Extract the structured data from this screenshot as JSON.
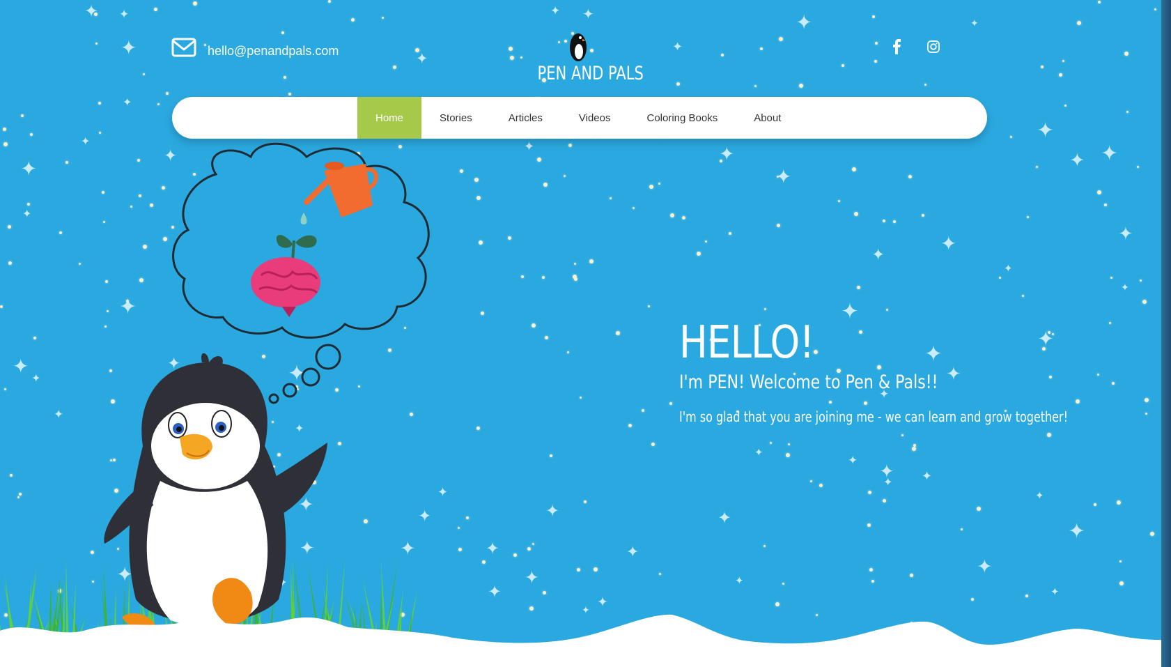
{
  "header": {
    "email": "hello@penandpals.com",
    "logo_text": "PEN AND PALS",
    "social_icons": [
      "facebook-icon",
      "instagram-icon"
    ]
  },
  "nav": {
    "items": [
      {
        "label": "Home",
        "active": true
      },
      {
        "label": "Stories"
      },
      {
        "label": "Articles"
      },
      {
        "label": "Videos"
      },
      {
        "label": "Coloring Books"
      },
      {
        "label": "About"
      }
    ]
  },
  "hero": {
    "title": "HELLO!",
    "subtitle": "I'm PEN! Welcome to Pen & Pals!!",
    "tagline": "I'm so glad that you are joining me - we can learn and grow together!"
  },
  "colors": {
    "sky": "#2aa9e0",
    "nav_active": "#a6c94a",
    "text": "#ffffff"
  }
}
